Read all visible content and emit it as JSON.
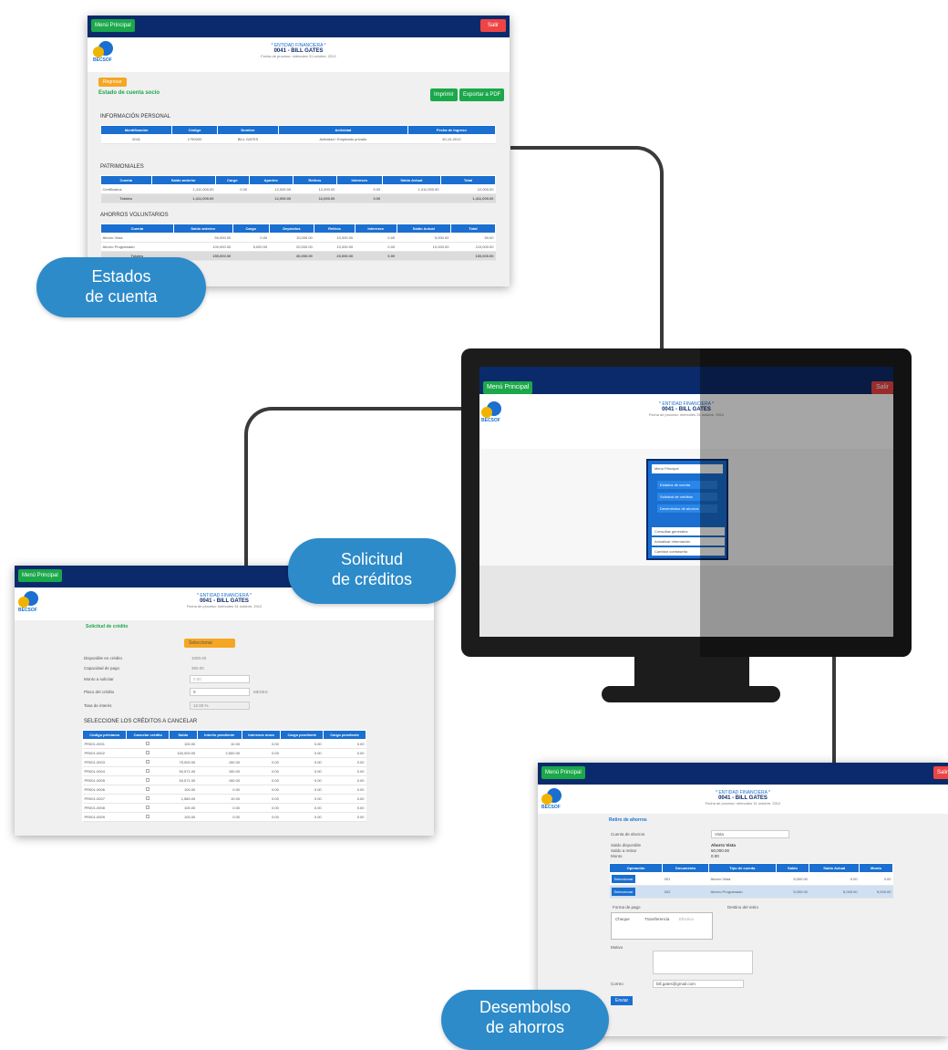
{
  "common": {
    "menu_label": "Menú Principal",
    "exit_label": "Salir",
    "logo_text": "BECSOF",
    "entity_title": "* ENTIDAD FINANCIERA *",
    "user_title": "0041 - BILL GATES",
    "subtitle": "Fecha de proceso: miércoles 31 octubre, 2012"
  },
  "estados": {
    "back_label": "Regresar",
    "section_title": "Estado de cuenta socio",
    "print_label": "Imprimir",
    "pdf_label": "Exportar a PDF",
    "personal_title": "INFORMACIÓN PERSONAL",
    "personal_headers": [
      "Identificación",
      "Código",
      "Nombre",
      "Actividad",
      "Fecha de Ingreso"
    ],
    "personal_row": [
      "0041",
      "1790000",
      "BILL GATES",
      "Actividad / Empleado privado",
      "30-10-2012"
    ],
    "patrimonial_title": "PATRIMONIALES",
    "patrimonial_headers": [
      "Cuenta",
      "Saldo anterior",
      "Cargo",
      "Aportes",
      "Retiros",
      "Intereses",
      "Saldo Actual",
      "Total"
    ],
    "patrimonial_rows": [
      [
        "Certificados",
        "1,411,000.00",
        "0.00",
        "12,000.00",
        "12,000.00",
        "0.00",
        "1,411,000.00",
        "12,000.00"
      ]
    ],
    "patrimonial_total": [
      "Totales",
      "1,411,000.00",
      "",
      "12,000.00",
      "12,000.00",
      "0.00",
      "",
      "1,411,000.00"
    ],
    "ahorros_title": "AHORROS VOLUNTARIOS",
    "ahorros_headers": [
      "Cuenta",
      "Saldo anterior",
      "Cargo",
      "Depósitos",
      "Retiros",
      "Intereses",
      "Saldo Actual",
      "Total"
    ],
    "ahorros_rows": [
      [
        "Ahorro Vista",
        "50,000.00",
        "0.00",
        "10,000.00",
        "10,000.00",
        "0.00",
        "5,000.00",
        "50.00"
      ],
      [
        "Ahorro Programado",
        "100,000.00",
        "5,000.00",
        "20,000.00",
        "10,000.00",
        "0.00",
        "10,000.00",
        "110,000.00"
      ]
    ],
    "ahorros_total": [
      "Totales",
      "150,000.00",
      "",
      "30,000.00",
      "20,000.00",
      "0.00",
      "",
      "160,000.00"
    ]
  },
  "monitor": {
    "menu_header": "Menú Principal",
    "menu_items": [
      "Estados de cuenta",
      "Solicitud de créditos",
      "Desembolso de ahorros"
    ],
    "menu_footer": [
      "Consultas generales",
      "Actualizar información",
      "Cambiar contraseña"
    ]
  },
  "solicitud": {
    "title": "Solicitud de crédito",
    "select_label": "Seleccionar",
    "fields": [
      {
        "label": "Disponible en crédito",
        "value": "1000.00"
      },
      {
        "label": "Capacidad de pago",
        "value": "350.00"
      },
      {
        "label": "Monto a solicitar",
        "value": "0.00"
      },
      {
        "label": "Plazo del crédito",
        "value": "0"
      },
      {
        "label": "Tasa de interés",
        "value": "12.00 %"
      }
    ],
    "plazo_unit": "MESES",
    "table_title": "SELECCIONE LOS CRÉDITOS A CANCELAR",
    "headers": [
      "Código préstamo",
      "Cancelar crédito",
      "Saldo",
      "Interés pendiente",
      "Intereses mora",
      "Cargo pendiente",
      "Cargo pendiente"
    ],
    "rows": [
      [
        "PR001-0001",
        "",
        "100.00",
        "10.00",
        "0.00",
        "0.00",
        "0.00"
      ],
      [
        "PR001-0002",
        "",
        "100,000.00",
        "2,500.00",
        "0.00",
        "0.00",
        "0.00"
      ],
      [
        "PR001-0003",
        "",
        "75,000.00",
        "150.00",
        "0.00",
        "0.00",
        "0.00"
      ],
      [
        "PR001-0004",
        "",
        "50,571.00",
        "150.00",
        "0.00",
        "0.00",
        "0.00"
      ],
      [
        "PR001-0005",
        "",
        "50,571.00",
        "150.00",
        "0.00",
        "0.00",
        "0.00"
      ],
      [
        "PR001-0006",
        "",
        "100.00",
        "0.00",
        "0.00",
        "0.00",
        "0.00"
      ],
      [
        "PR001-0007",
        "",
        "1,580.00",
        "10.00",
        "0.00",
        "0.00",
        "0.00"
      ],
      [
        "PR001-0008",
        "",
        "100.00",
        "0.00",
        "0.00",
        "0.00",
        "0.00"
      ],
      [
        "PR001-0009",
        "",
        "100.00",
        "0.00",
        "0.00",
        "0.00",
        "0.00"
      ]
    ]
  },
  "desembolso": {
    "title": "Retiro de ahorros",
    "tipo_label": "Cuenta de ahorros",
    "tipo_value": "Vista",
    "info_labels": [
      "Saldo disponible",
      "Saldo a retirar",
      "Monto"
    ],
    "info_values": [
      "Ahorro Vista",
      "50,000.00",
      "0.00"
    ],
    "table_headers": [
      "Operación",
      "Documento",
      "Tipo de cuenta",
      "Saldo",
      "Saldo Actual",
      "Monto"
    ],
    "table_rows": [
      [
        "Seleccionar",
        "001",
        "Ahorro Vista",
        "5,000.00",
        "0.00",
        "0.00"
      ],
      [
        "Seleccionar",
        "002",
        "Ahorro Programado",
        "5,000.00",
        "5,000.00",
        "5,000.00"
      ]
    ],
    "forma_label": "Forma de pago",
    "cheque_label": "Cheque",
    "transfer_label": "Transferencia",
    "efectivo_label": "Efectivo",
    "destino_label": "Destino del retiro",
    "motivo_label": "Motivo",
    "correo_label": "Correo",
    "correo_value": "bill.gates@gmail.com",
    "send_label": "Enviar"
  },
  "bubbles": {
    "estados": [
      "Estados",
      "de cuenta"
    ],
    "solicitud": [
      "Solicitud",
      "de créditos"
    ],
    "desembolso": [
      "Desembolso",
      "de ahorros"
    ]
  }
}
